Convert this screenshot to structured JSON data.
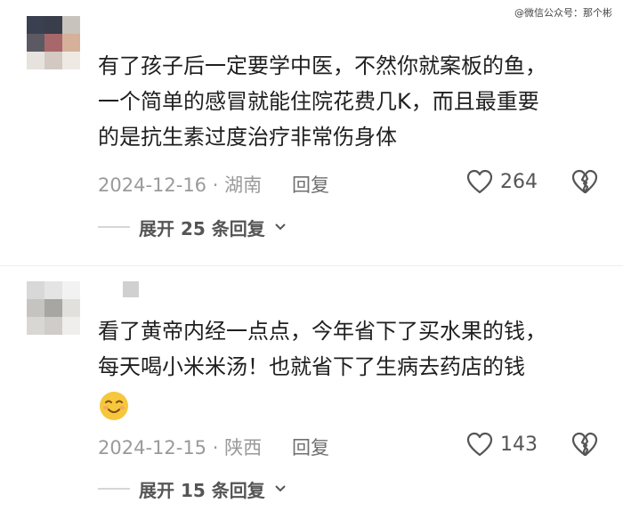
{
  "watermark": "@微信公众号：那个彬",
  "comments": [
    {
      "text_lines": [
        "有了孩子后一定要学中医，不然你就案板的鱼，",
        "一个简单的感冒就能住院花费几K，而且最重要",
        "的是抗生素过度治疗非常伤身体"
      ],
      "date_location": "2024-12-16 · 湖南",
      "reply_label": "回复",
      "like_count": "264",
      "expand_label": "展开 25 条回复",
      "avatar_colors": [
        "#3b4050",
        "#3a3d4a",
        "#c9c3bd",
        "#5b5a63",
        "#a8676a",
        "#d5b19a",
        "#e6e3df",
        "#d3c9c2",
        "#efe9e4"
      ]
    },
    {
      "text_lines": [
        "看了黄帝内经一点点，今年省下了买水果的钱，",
        "每天喝小米米汤！也就省下了生病去药店的钱"
      ],
      "emoji": "smiling-emoji",
      "date_location": "2024-12-15 · 陕西",
      "reply_label": "回复",
      "like_count": "143",
      "expand_label": "展开 15 条回复",
      "avatar_colors": [
        "#d8d8d8",
        "#e4e4e4",
        "#f2f2f2",
        "#c6c4c1",
        "#a8a6a3",
        "#e2e0dd",
        "#d9d7d4",
        "#cfccc9",
        "#efeeec"
      ]
    }
  ],
  "colors": {
    "text": "#1f1f1f",
    "meta": "#9a9a9a",
    "emoji_fill": "#f6c73c"
  }
}
